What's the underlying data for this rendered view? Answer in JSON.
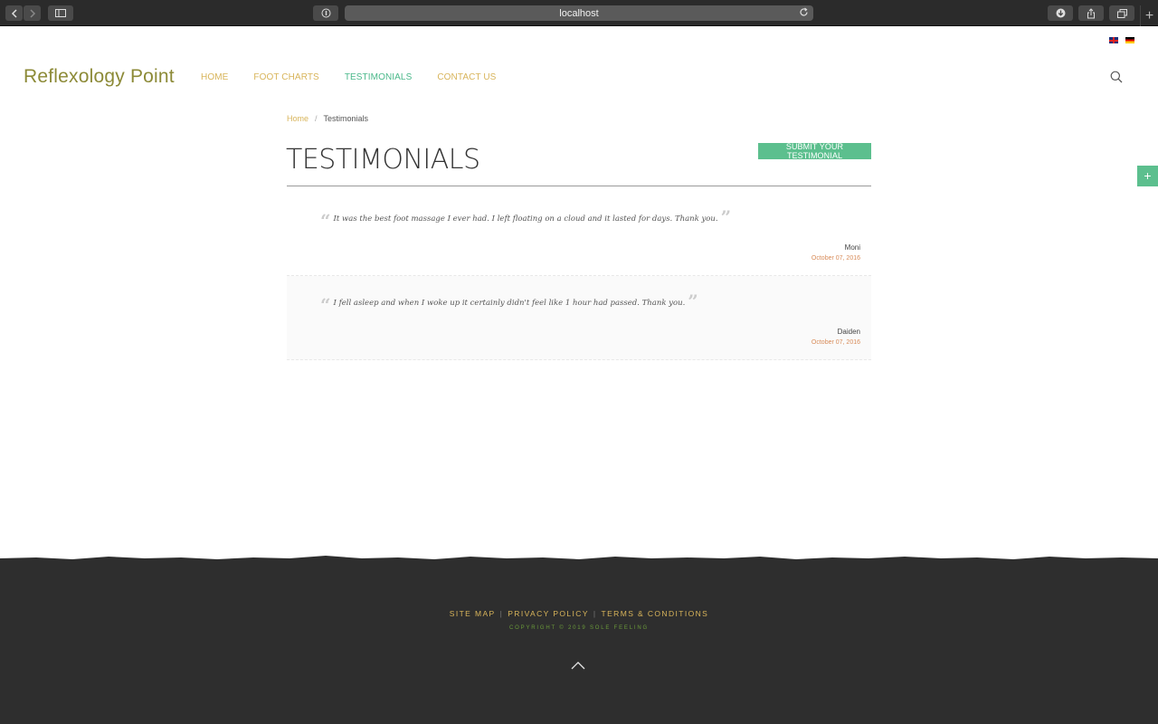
{
  "browser": {
    "url": "localhost"
  },
  "site": {
    "logo": "Reflexology Point",
    "nav": [
      "HOME",
      "FOOT CHARTS",
      "TESTIMONIALS",
      "CONTACT US"
    ],
    "active_nav": "TESTIMONIALS",
    "languages": [
      "English",
      "Deutsch"
    ]
  },
  "breadcrumb": {
    "home": "Home",
    "separator": "/",
    "current": "Testimonials"
  },
  "page": {
    "title": "TESTIMONIALS",
    "submit_label": "SUBMIT YOUR TESTIMONIAL"
  },
  "testimonials": [
    {
      "text": "It was the best foot massage I ever had. I left floating on a cloud and it lasted for days. Thank you.",
      "author": "Moni",
      "date": "October 07, 2016"
    },
    {
      "text": "I fell asleep and when I woke up it certainly didn't feel like 1 hour had passed. Thank you.",
      "author": "Daiden",
      "date": "October 07, 2016"
    }
  ],
  "footer": {
    "links": [
      "SITE MAP",
      "PRIVACY POLICY",
      "TERMS & CONDITIONS"
    ],
    "copyright": "COPYRIGHT © 2019 SOLE FEELING"
  },
  "colors": {
    "accent_green": "#5cbf8e",
    "nav_gold": "#d8b45a",
    "logo_olive": "#8c8a37",
    "date_orange": "#d88c5a",
    "footer_bg": "#2e2e2e"
  }
}
